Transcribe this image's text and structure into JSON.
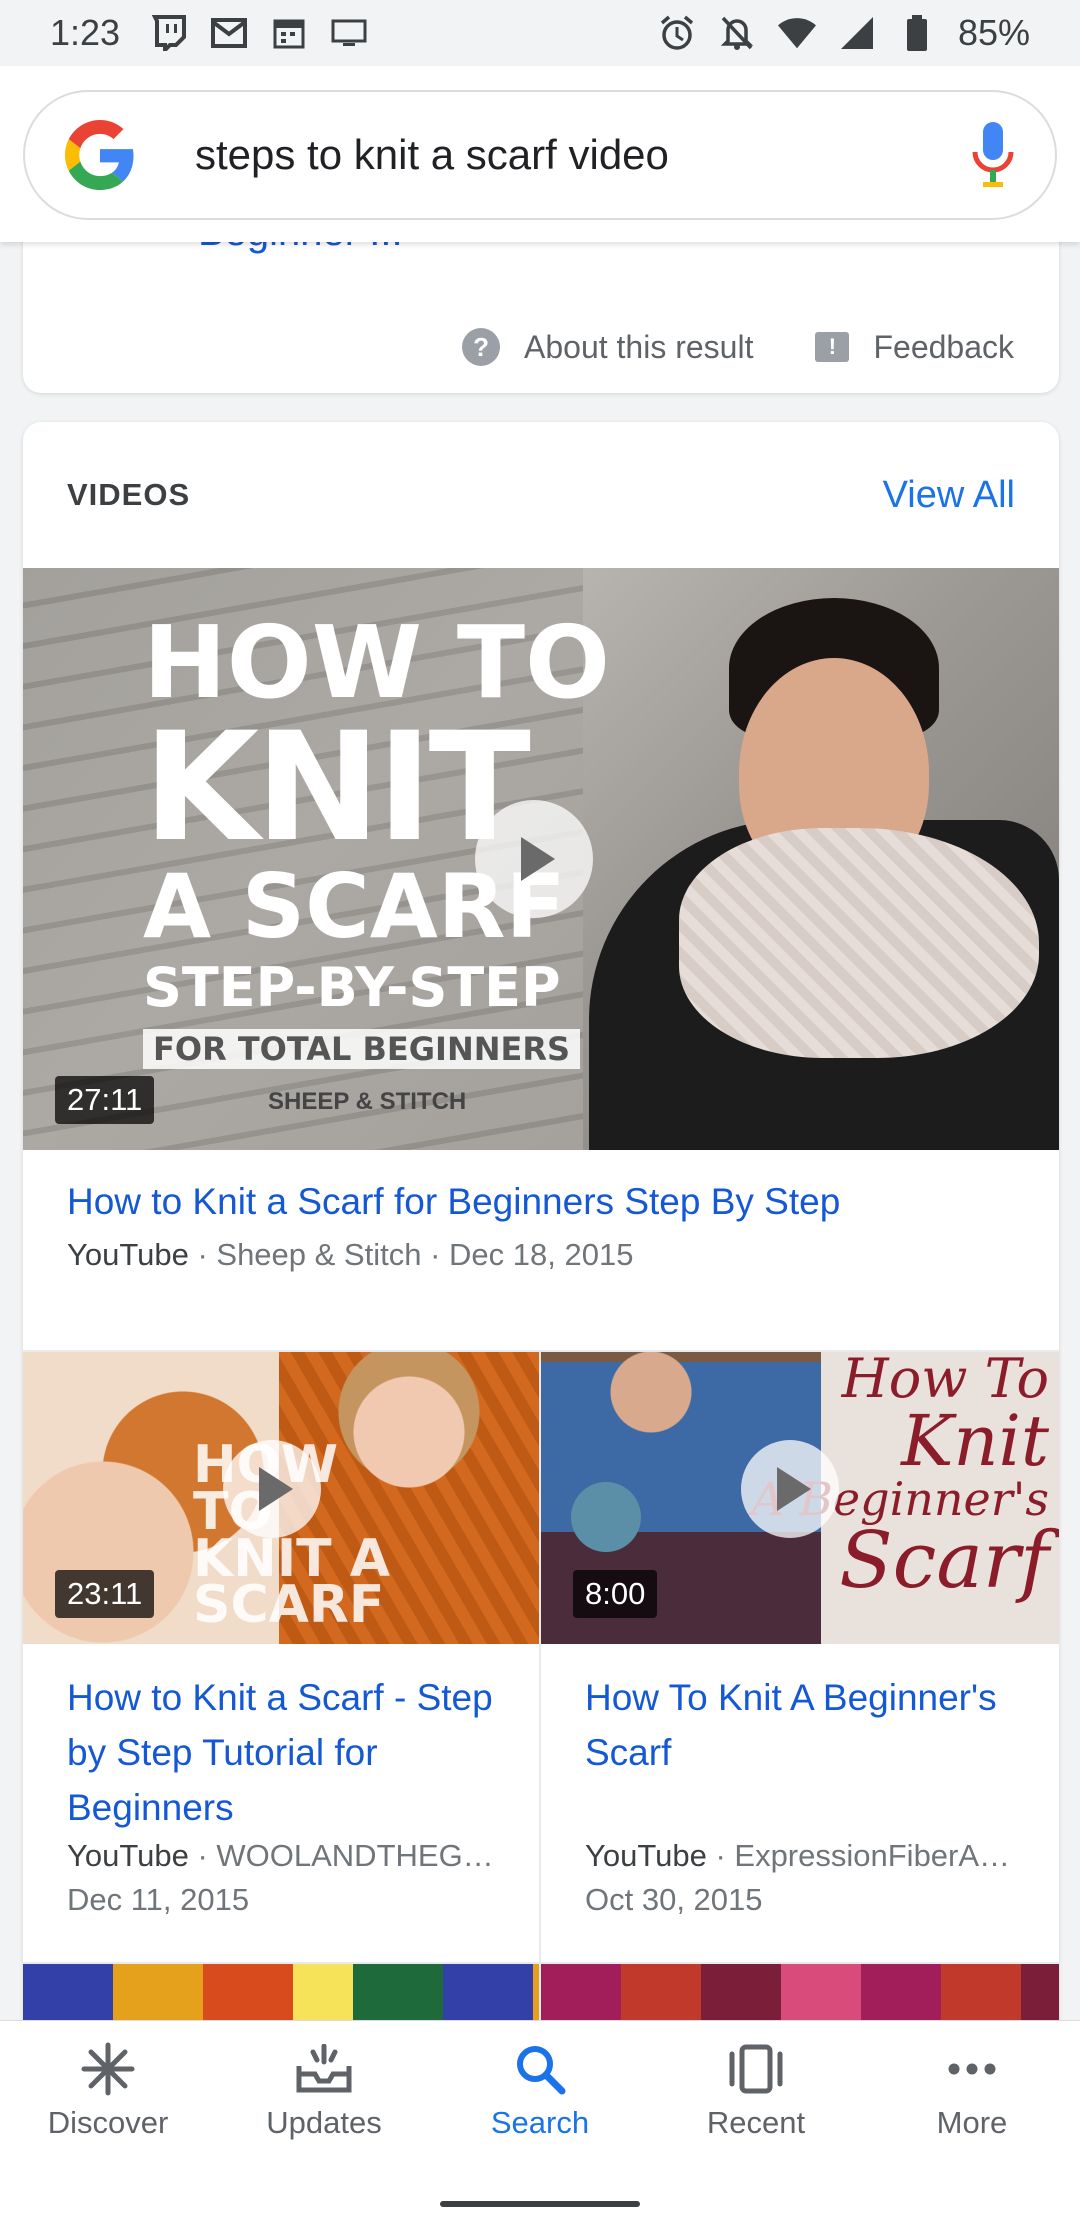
{
  "status_bar": {
    "time": "1:23",
    "battery": "85%",
    "left_icons": [
      "twitch-icon",
      "gmail-icon",
      "calendar-icon",
      "cast-icon"
    ],
    "right_icons": [
      "alarm-icon",
      "notifications-off-icon",
      "wifi-icon",
      "signal-icon",
      "battery-icon"
    ]
  },
  "search": {
    "query": "steps to knit a scarf video"
  },
  "previous_result": {
    "partial_title": "Beginner ...",
    "about_label": "About this result",
    "feedback_label": "Feedback"
  },
  "videos": {
    "section_label": "VIDEOS",
    "view_all_label": "View All",
    "featured": {
      "duration": "27:11",
      "title": "How to Knit a Scarf for Beginners Step By Step",
      "source": "YouTube",
      "channel": "Sheep & Stitch",
      "date": "Dec 18, 2015",
      "thumb_text": {
        "line1": "HOW TO",
        "line2": "KNIT",
        "line3": "A SCARF",
        "line4": "STEP-BY-STEP",
        "line5": "FOR TOTAL BEGINNERS",
        "brand": "SHEEP & STITCH"
      }
    },
    "items": [
      {
        "duration": "23:11",
        "title": "How to Knit a Scarf - Step by Step Tutorial for Beginners",
        "source": "YouTube",
        "channel": "WOOLANDTHEG…",
        "date": "Dec 11, 2015",
        "thumb_text": "HOW TO KNIT A SCARF"
      },
      {
        "duration": "8:00",
        "title": "How To Knit A Beginner's Scarf",
        "source": "YouTube",
        "channel": "ExpressionFiberA…",
        "date": "Oct 30, 2015",
        "thumb_text": {
          "line1": "How To",
          "line2": "Knit",
          "line3": "A Beginner's",
          "line4": "Scarf"
        }
      }
    ]
  },
  "bottom_nav": {
    "items": [
      {
        "label": "Discover",
        "icon": "asterisk-icon",
        "active": false
      },
      {
        "label": "Updates",
        "icon": "inbox-icon",
        "active": false
      },
      {
        "label": "Search",
        "icon": "search-icon",
        "active": true
      },
      {
        "label": "Recent",
        "icon": "recent-cards-icon",
        "active": false
      },
      {
        "label": "More",
        "icon": "more-dots-icon",
        "active": false
      }
    ]
  },
  "colors": {
    "accent_blue": "#1a73e8",
    "link_blue": "#1558d6",
    "background": "#f1f3f4"
  }
}
